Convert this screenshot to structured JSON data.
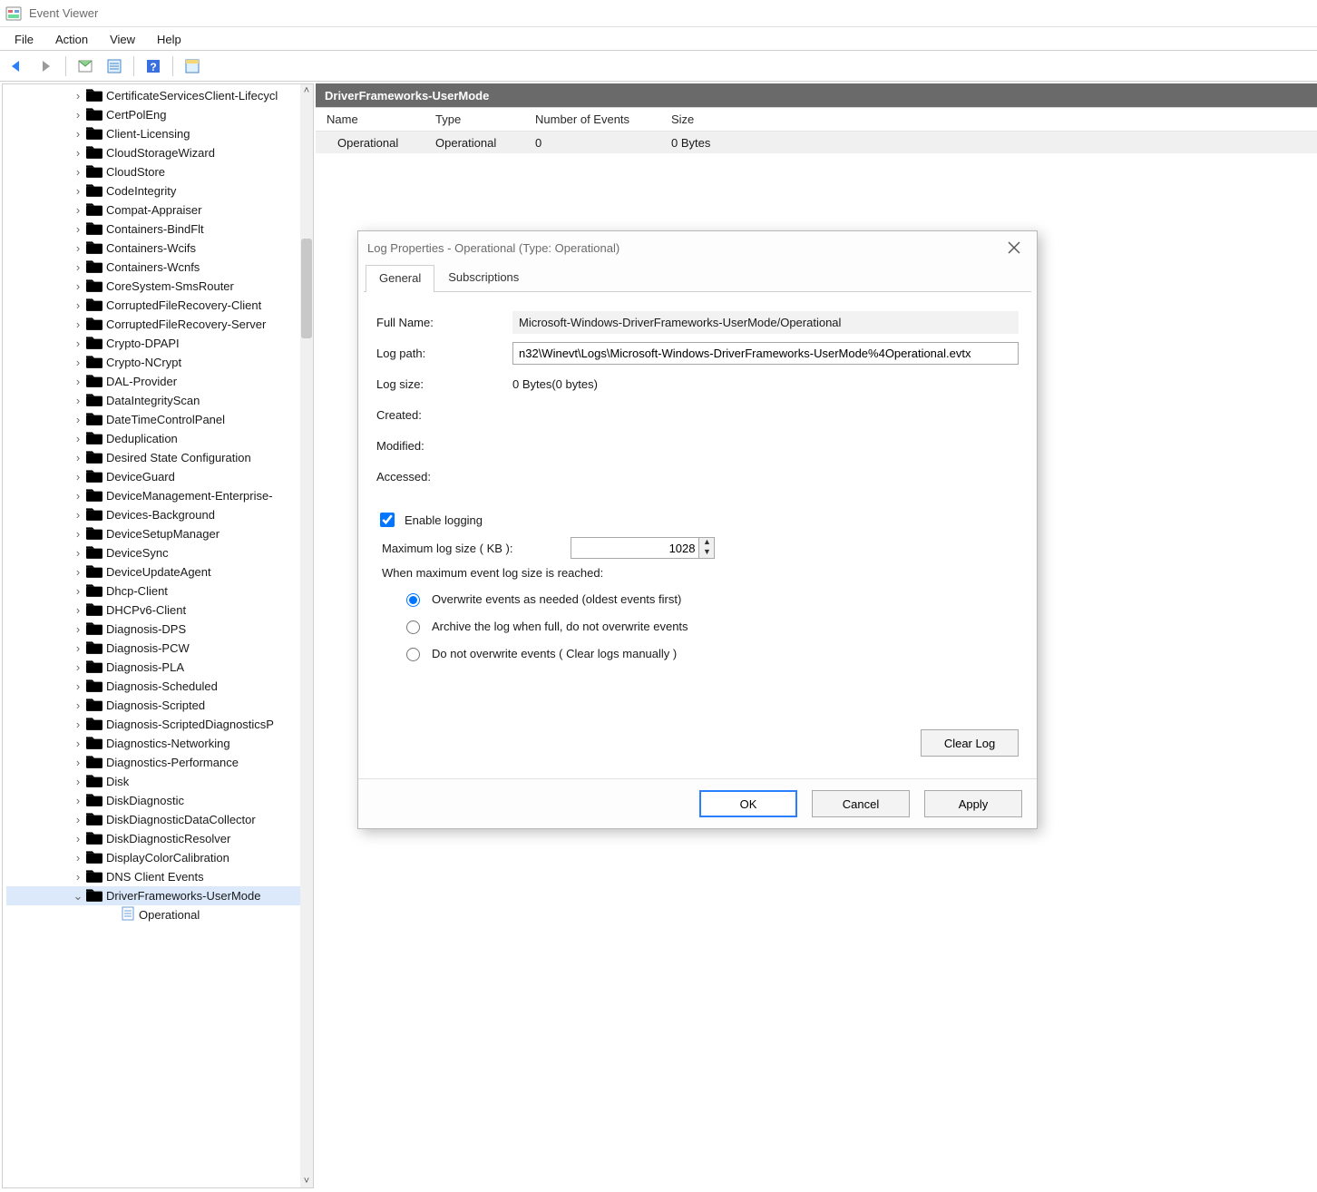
{
  "window": {
    "title": "Event Viewer"
  },
  "menu": {
    "file": "File",
    "action": "Action",
    "view": "View",
    "help": "Help"
  },
  "section_header": "DriverFrameworks-UserMode",
  "columns": {
    "name": "Name",
    "type": "Type",
    "events": "Number of Events",
    "size": "Size"
  },
  "row": {
    "name": "Operational",
    "type": "Operational",
    "events": "0",
    "size": "0 Bytes"
  },
  "tree": {
    "items": [
      "CertificateServicesClient-Lifecycl",
      "CertPolEng",
      "Client-Licensing",
      "CloudStorageWizard",
      "CloudStore",
      "CodeIntegrity",
      "Compat-Appraiser",
      "Containers-BindFlt",
      "Containers-Wcifs",
      "Containers-Wcnfs",
      "CoreSystem-SmsRouter",
      "CorruptedFileRecovery-Client",
      "CorruptedFileRecovery-Server",
      "Crypto-DPAPI",
      "Crypto-NCrypt",
      "DAL-Provider",
      "DataIntegrityScan",
      "DateTimeControlPanel",
      "Deduplication",
      "Desired State Configuration",
      "DeviceGuard",
      "DeviceManagement-Enterprise-",
      "Devices-Background",
      "DeviceSetupManager",
      "DeviceSync",
      "DeviceUpdateAgent",
      "Dhcp-Client",
      "DHCPv6-Client",
      "Diagnosis-DPS",
      "Diagnosis-PCW",
      "Diagnosis-PLA",
      "Diagnosis-Scheduled",
      "Diagnosis-Scripted",
      "Diagnosis-ScriptedDiagnosticsP",
      "Diagnostics-Networking",
      "Diagnostics-Performance",
      "Disk",
      "DiskDiagnostic",
      "DiskDiagnosticDataCollector",
      "DiskDiagnosticResolver",
      "DisplayColorCalibration",
      "DNS Client Events",
      "DriverFrameworks-UserMode"
    ],
    "expanded_index": 42,
    "child_label": "Operational"
  },
  "dialog": {
    "title": "Log Properties - Operational (Type: Operational)",
    "tabs": {
      "general": "General",
      "subscriptions": "Subscriptions"
    },
    "labels": {
      "full_name": "Full Name:",
      "log_path": "Log path:",
      "log_size": "Log size:",
      "created": "Created:",
      "modified": "Modified:",
      "accessed": "Accessed:",
      "enable_logging": "Enable logging",
      "max_size": "Maximum log size ( KB ):",
      "when_full": "When maximum event log size is reached:"
    },
    "values": {
      "full_name": "Microsoft-Windows-DriverFrameworks-UserMode/Operational",
      "log_path": "n32\\Winevt\\Logs\\Microsoft-Windows-DriverFrameworks-UserMode%4Operational.evtx",
      "log_size": "0 Bytes(0 bytes)",
      "max_kb": "1028"
    },
    "radios": {
      "overwrite": "Overwrite events as needed (oldest events first)",
      "archive": "Archive the log when full, do not overwrite events",
      "none": "Do not overwrite events ( Clear logs manually )"
    },
    "buttons": {
      "clear": "Clear Log",
      "ok": "OK",
      "cancel": "Cancel",
      "apply": "Apply"
    }
  }
}
